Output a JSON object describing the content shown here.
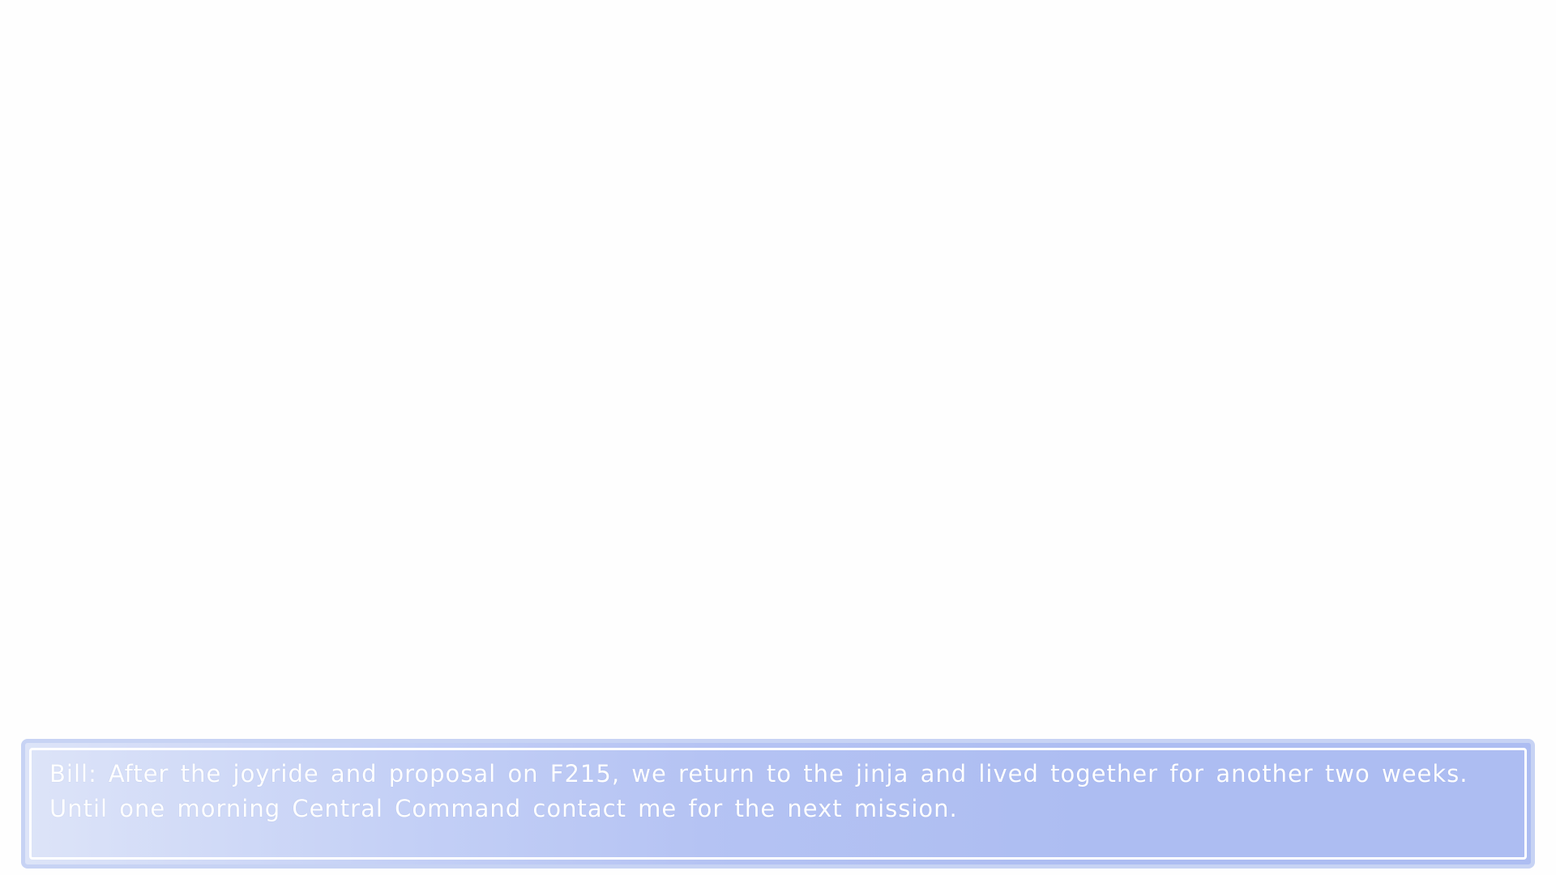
{
  "dialogue": {
    "speaker": "Bill:",
    "text": "After the joyride and proposal on F215, we return to the jinja and lived together for another two weeks. Until one morning Central Command contact me for the next mission."
  },
  "colors": {
    "background": "#fefefe",
    "textbox_gradient_start": "#dde4f8",
    "textbox_gradient_end": "#adbdf2",
    "textbox_border": "#c7d3f4",
    "text": "#ffffff"
  }
}
